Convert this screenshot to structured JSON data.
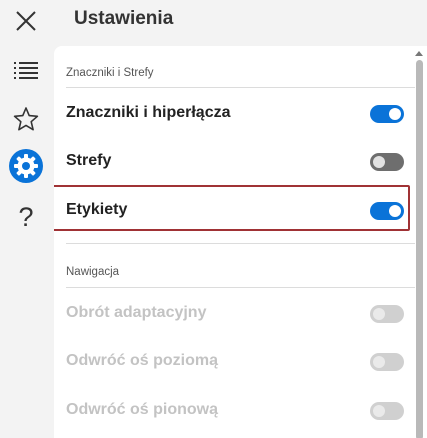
{
  "header": {
    "title": "Ustawienia"
  },
  "rail": {
    "close_icon": "close-icon",
    "list_icon": "list-icon",
    "favorites_icon": "star-icon",
    "settings_icon": "gear-icon",
    "help_icon": "question-icon",
    "active_color": "#0a73d8"
  },
  "sections": [
    {
      "label": "Znaczniki i Strefy",
      "items": [
        {
          "label": "Znaczniki i hiperłącza",
          "state": "on"
        },
        {
          "label": "Strefy",
          "state": "off"
        },
        {
          "label": "Etykiety",
          "state": "on",
          "highlighted": true
        }
      ]
    },
    {
      "label": "Nawigacja",
      "items": [
        {
          "label": "Obrót adaptacyjny",
          "state": "disabled"
        },
        {
          "label": "Odwróć oś poziomą",
          "state": "disabled"
        },
        {
          "label": "Odwróć oś pionową",
          "state": "disabled"
        }
      ]
    }
  ],
  "colors": {
    "toggle_on": "#0a73d8",
    "toggle_off": "#6e6e6e",
    "highlight_border": "#a03235"
  }
}
